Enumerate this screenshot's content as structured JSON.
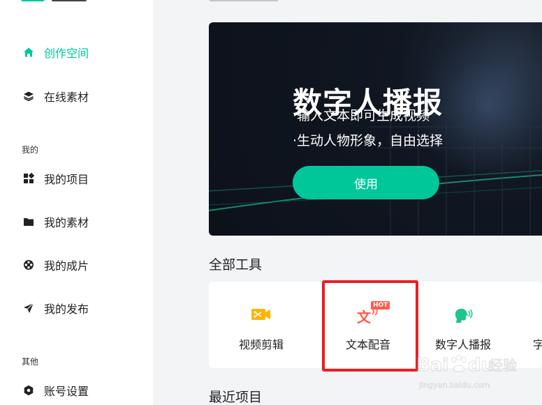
{
  "sidebar": {
    "items": [
      {
        "label": "创作空间",
        "icon": "home-icon",
        "active": true
      },
      {
        "label": "在线素材",
        "icon": "layers-icon",
        "active": false
      }
    ],
    "section_mine": "我的",
    "mine_items": [
      {
        "label": "我的项目",
        "icon": "grid-icon"
      },
      {
        "label": "我的素材",
        "icon": "folder-icon"
      },
      {
        "label": "我的成片",
        "icon": "film-reel-icon"
      },
      {
        "label": "我的发布",
        "icon": "send-icon"
      }
    ],
    "section_other": "其他",
    "other_items": [
      {
        "label": "账号设置",
        "icon": "settings-hex-icon"
      }
    ]
  },
  "banner": {
    "title": "数字人播报",
    "bullet1": "·输入文本即可生成视频",
    "bullet2": "·生动人物形象，自由选择",
    "button": "使用"
  },
  "tools": {
    "heading": "全部工具",
    "items": [
      {
        "label": "视频剪辑",
        "icon": "video-scissors-icon"
      },
      {
        "label": "文本配音",
        "icon": "text-voice-icon",
        "badge": "HOT",
        "glyph": "文"
      },
      {
        "label": "数字人播报",
        "icon": "speaking-head-icon"
      },
      {
        "label": "字",
        "icon": "truncated-tool"
      }
    ]
  },
  "recent": {
    "heading": "最近项目"
  },
  "colors": {
    "accent": "#00c79a",
    "highlight": "#ee1c24",
    "hot_badge": "#ff5b4a",
    "video_icon": "#ffb400",
    "text_icon": "#ff5b4a",
    "avatar_icon": "#20c58b"
  },
  "watermark": {
    "brand": "Bai du 经验",
    "url": "jingyan.baidu.com"
  }
}
